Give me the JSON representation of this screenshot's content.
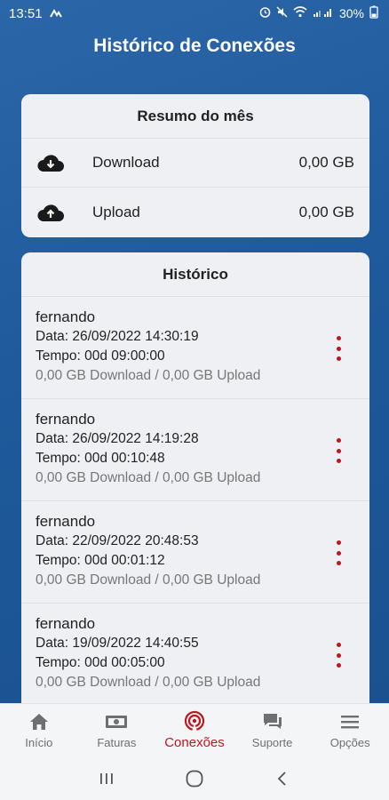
{
  "status_bar": {
    "time": "13:51",
    "battery": "30%"
  },
  "header": {
    "title": "Histórico de Conexões"
  },
  "summary": {
    "title": "Resumo do mês",
    "rows": [
      {
        "label": "Download",
        "value": "0,00 GB",
        "icon": "cloud-download-icon"
      },
      {
        "label": "Upload",
        "value": "0,00 GB",
        "icon": "cloud-upload-icon"
      }
    ]
  },
  "history": {
    "title": "Histórico",
    "items": [
      {
        "name": "fernando",
        "date": "Data: 26/09/2022 14:30:19",
        "time": "Tempo: 00d 09:00:00",
        "usage": "0,00 GB Download / 0,00 GB Upload"
      },
      {
        "name": "fernando",
        "date": "Data: 26/09/2022 14:19:28",
        "time": "Tempo: 00d 00:10:48",
        "usage": "0,00 GB Download / 0,00 GB Upload"
      },
      {
        "name": "fernando",
        "date": "Data: 22/09/2022 20:48:53",
        "time": "Tempo: 00d 00:01:12",
        "usage": "0,00 GB Download / 0,00 GB Upload"
      },
      {
        "name": "fernando",
        "date": "Data: 19/09/2022 14:40:55",
        "time": "Tempo: 00d 00:05:00",
        "usage": "0,00 GB Download / 0,00 GB Upload"
      }
    ]
  },
  "bottom_nav": {
    "items": [
      {
        "label": "Início",
        "icon": "home-icon"
      },
      {
        "label": "Faturas",
        "icon": "banknote-icon"
      },
      {
        "label": "Conexões",
        "icon": "signal-icon",
        "active": true
      },
      {
        "label": "Suporte",
        "icon": "chat-icon"
      },
      {
        "label": "Opções",
        "icon": "menu-icon"
      }
    ]
  },
  "colors": {
    "accent": "#c0161f",
    "background": "#1e5a9c",
    "card": "#eef0f4"
  }
}
